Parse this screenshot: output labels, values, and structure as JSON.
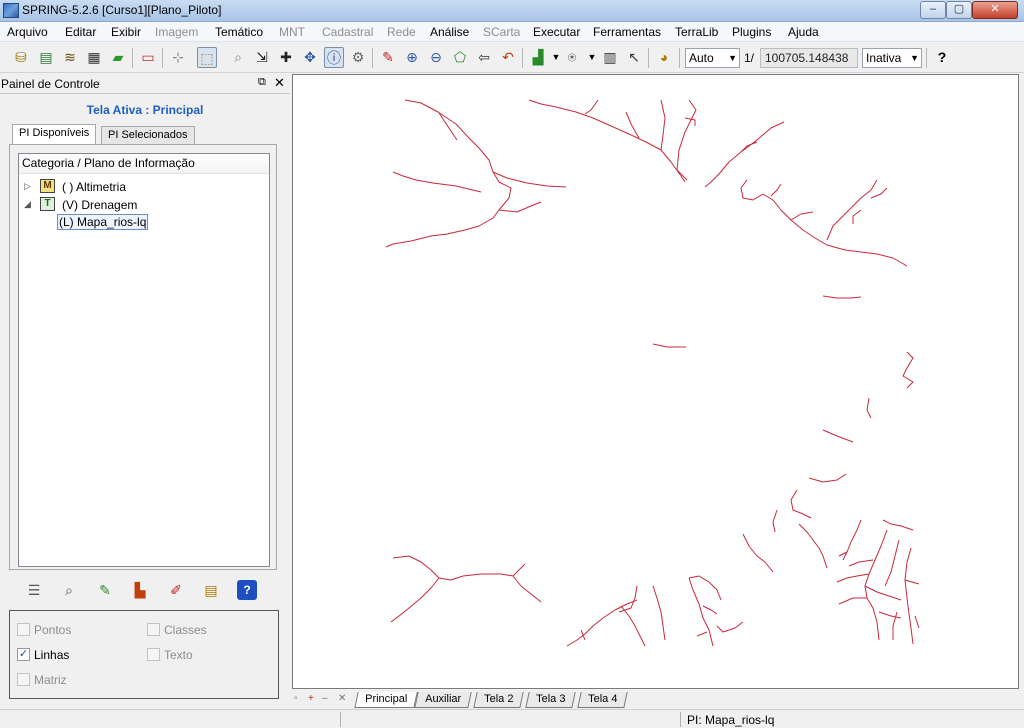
{
  "window": {
    "title": "SPRING-5.2.6 [Curso1][Plano_Piloto]",
    "minimize": "–",
    "maximize": "▢",
    "close": "✕"
  },
  "menu": [
    {
      "label": "Arquivo",
      "enabled": true
    },
    {
      "label": "Editar",
      "enabled": true
    },
    {
      "label": "Exibir",
      "enabled": true
    },
    {
      "label": "Imagem",
      "enabled": false
    },
    {
      "label": "Temático",
      "enabled": true
    },
    {
      "label": "MNT",
      "enabled": false
    },
    {
      "label": "Cadastral",
      "enabled": false
    },
    {
      "label": "Rede",
      "enabled": false
    },
    {
      "label": "Análise",
      "enabled": true
    },
    {
      "label": "SCarta",
      "enabled": false
    },
    {
      "label": "Executar",
      "enabled": true
    },
    {
      "label": "Ferramentas",
      "enabled": true
    },
    {
      "label": "TerraLib",
      "enabled": true
    },
    {
      "label": "Plugins",
      "enabled": true
    },
    {
      "label": "Ajuda",
      "enabled": true
    }
  ],
  "toolbar": {
    "scale_mode": "Auto",
    "scale_prefix": "1/",
    "scale_value": "100705.148438",
    "status_select": "Inativa",
    "help": "?"
  },
  "panel": {
    "title": "Painel de Controle",
    "float": "⧉",
    "close": "✕",
    "active_screen": "Tela Ativa : Principal",
    "tabs": [
      "PI Disponíveis",
      "PI Selecionados"
    ],
    "tree_header": "Categoria / Plano de Informação",
    "categories": [
      {
        "icon": "M",
        "label": "( ) Altimetria",
        "expanded": false
      },
      {
        "icon": "T",
        "label": "(V) Drenagem",
        "expanded": true
      }
    ],
    "selected_pi": "(L) Mapa_rios-lq",
    "options": [
      {
        "label": "Pontos",
        "checked": false,
        "enabled": false
      },
      {
        "label": "Classes",
        "checked": false,
        "enabled": false
      },
      {
        "label": "Linhas",
        "checked": true,
        "enabled": true
      },
      {
        "label": "Texto",
        "checked": false,
        "enabled": false
      },
      {
        "label": "Matriz",
        "checked": false,
        "enabled": false
      }
    ]
  },
  "screen_tabs": [
    "Principal",
    "Auxiliar",
    "Tela 2",
    "Tela 3",
    "Tela 4"
  ],
  "status": {
    "pi": "PI: Mapa_rios-lq"
  },
  "colors": {
    "river_line": "#c8283a",
    "active_screen_text": "#1f5fbf"
  }
}
